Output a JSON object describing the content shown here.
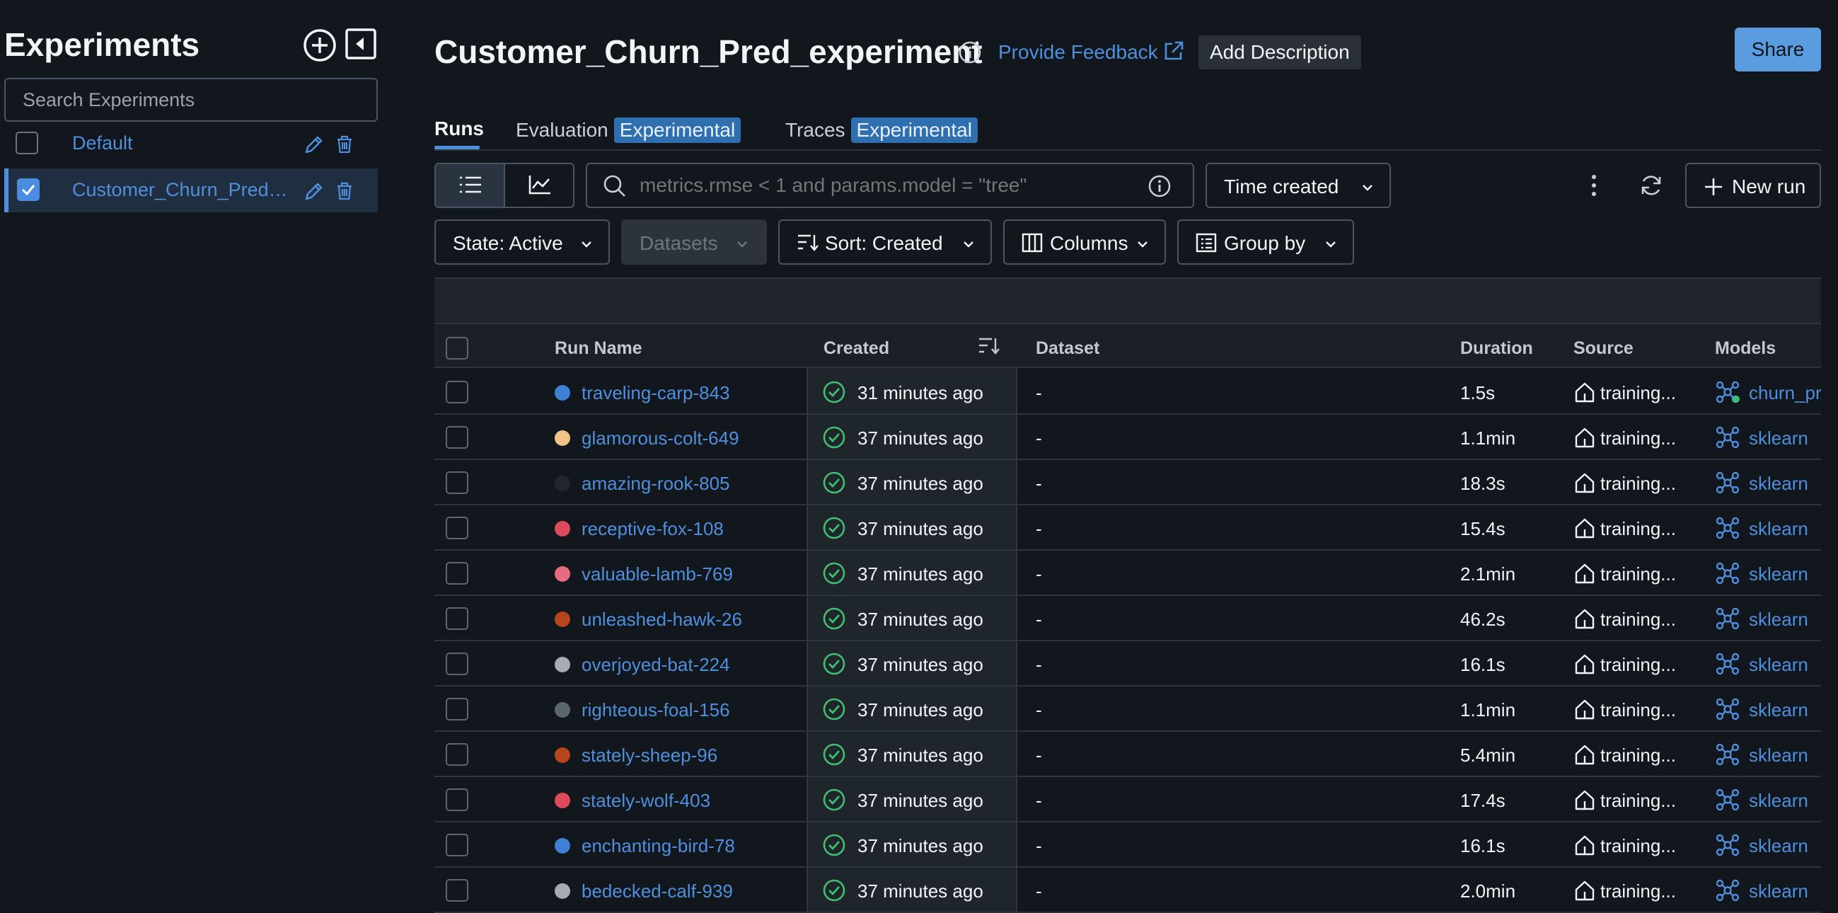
{
  "sidebar": {
    "title": "Experiments",
    "search_placeholder": "Search Experiments",
    "experiments": [
      {
        "name": "Default",
        "checked": false
      },
      {
        "name": "Customer_Churn_Pred_experiment",
        "checked": true
      }
    ]
  },
  "header": {
    "title": "Customer_Churn_Pred_experiment",
    "feedback_label": "Provide Feedback",
    "add_description_label": "Add Description",
    "share_label": "Share"
  },
  "tabs": [
    {
      "label": "Runs",
      "badge": ""
    },
    {
      "label": "Evaluation",
      "badge": "Experimental"
    },
    {
      "label": "Traces",
      "badge": "Experimental"
    }
  ],
  "toolbar": {
    "filter_placeholder": "metrics.rmse < 1 and params.model = \"tree\"",
    "time_label": "Time created",
    "new_run_label": "New run",
    "state_label": "State: Active",
    "datasets_label": "Datasets",
    "sort_label": "Sort: Created",
    "columns_label": "Columns",
    "group_by_label": "Group by"
  },
  "table": {
    "columns": [
      "Run Name",
      "Created",
      "Dataset",
      "Duration",
      "Source",
      "Models"
    ],
    "rows": [
      {
        "name": "traveling-carp-843",
        "color": "#3f7fd4",
        "created": "31 minutes ago",
        "dataset": "-",
        "duration": "1.5s",
        "source": "training...",
        "model": "churn_pred"
      },
      {
        "name": "glamorous-colt-649",
        "color": "#f2c48a",
        "created": "37 minutes ago",
        "dataset": "-",
        "duration": "1.1min",
        "source": "training...",
        "model": "sklearn"
      },
      {
        "name": "amazing-rook-805",
        "color": "#22272d",
        "created": "37 minutes ago",
        "dataset": "-",
        "duration": "18.3s",
        "source": "training...",
        "model": "sklearn"
      },
      {
        "name": "receptive-fox-108",
        "color": "#de4a5c",
        "created": "37 minutes ago",
        "dataset": "-",
        "duration": "15.4s",
        "source": "training...",
        "model": "sklearn"
      },
      {
        "name": "valuable-lamb-769",
        "color": "#e86c80",
        "created": "37 minutes ago",
        "dataset": "-",
        "duration": "2.1min",
        "source": "training...",
        "model": "sklearn"
      },
      {
        "name": "unleashed-hawk-26",
        "color": "#b5451b",
        "created": "37 minutes ago",
        "dataset": "-",
        "duration": "46.2s",
        "source": "training...",
        "model": "sklearn"
      },
      {
        "name": "overjoyed-bat-224",
        "color": "#a6acb3",
        "created": "37 minutes ago",
        "dataset": "-",
        "duration": "16.1s",
        "source": "training...",
        "model": "sklearn"
      },
      {
        "name": "righteous-foal-156",
        "color": "#5c666f",
        "created": "37 minutes ago",
        "dataset": "-",
        "duration": "1.1min",
        "source": "training...",
        "model": "sklearn"
      },
      {
        "name": "stately-sheep-96",
        "color": "#b5451b",
        "created": "37 minutes ago",
        "dataset": "-",
        "duration": "5.4min",
        "source": "training...",
        "model": "sklearn"
      },
      {
        "name": "stately-wolf-403",
        "color": "#de4a5c",
        "created": "37 minutes ago",
        "dataset": "-",
        "duration": "17.4s",
        "source": "training...",
        "model": "sklearn"
      },
      {
        "name": "enchanting-bird-78",
        "color": "#3f7fd4",
        "created": "37 minutes ago",
        "dataset": "-",
        "duration": "16.1s",
        "source": "training...",
        "model": "sklearn"
      },
      {
        "name": "bedecked-calf-939",
        "color": "#a6acb3",
        "created": "37 minutes ago",
        "dataset": "-",
        "duration": "2.0min",
        "source": "training...",
        "model": "sklearn"
      }
    ]
  }
}
